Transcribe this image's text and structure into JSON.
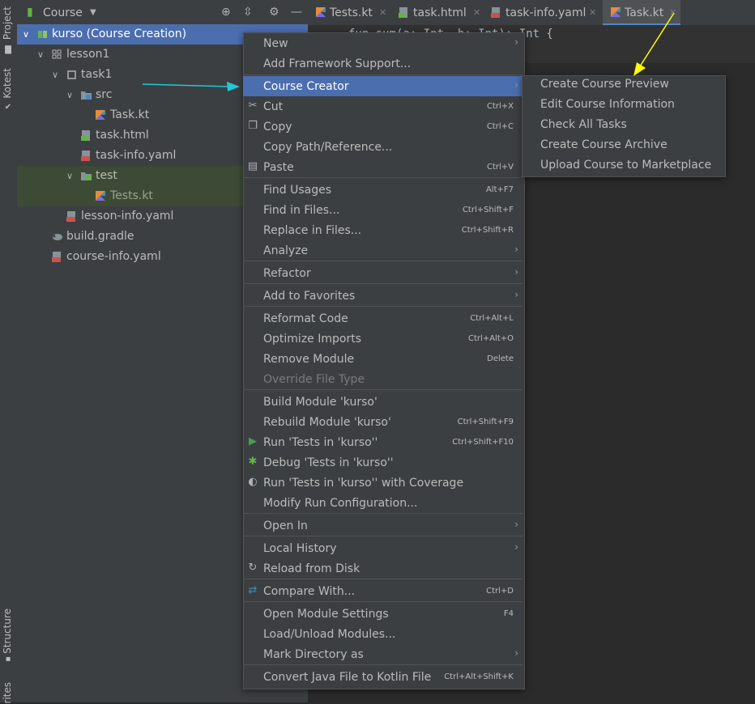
{
  "toolstrip": {
    "project": "Project",
    "kotest": "Kotest",
    "structure": "Structure",
    "favorites": "rites"
  },
  "project_panel": {
    "title": "Course",
    "tree": [
      {
        "label": "kurso (Course Creation)"
      },
      {
        "label": "lesson1"
      },
      {
        "label": "task1"
      },
      {
        "label": "src"
      },
      {
        "label": "Task.kt"
      },
      {
        "label": "task.html"
      },
      {
        "label": "task-info.yaml"
      },
      {
        "label": "test"
      },
      {
        "label": "Tests.kt"
      },
      {
        "label": "lesson-info.yaml"
      },
      {
        "label": "build.gradle"
      },
      {
        "label": "course-info.yaml"
      }
    ]
  },
  "tabs": [
    {
      "label": "Tests.kt"
    },
    {
      "label": "task.html"
    },
    {
      "label": "task-info.yaml"
    },
    {
      "label": "Task.kt",
      "active": true
    }
  ],
  "editor": {
    "code_fragment": "fun sum(a: Int, b: Int): Int {"
  },
  "context_menu": {
    "items": [
      {
        "label": "New",
        "submenu": true
      },
      {
        "label": "Add Framework Support..."
      },
      {
        "label": "Course Creator",
        "submenu": true,
        "highlighted": true
      },
      {
        "label": "Cut",
        "shortcut": "Ctrl+X",
        "icon": "scissors-icon"
      },
      {
        "label": "Copy",
        "shortcut": "Ctrl+C",
        "icon": "copy-icon"
      },
      {
        "label": "Copy Path/Reference..."
      },
      {
        "label": "Paste",
        "shortcut": "Ctrl+V",
        "icon": "paste-icon"
      },
      {
        "label": "Find Usages",
        "shortcut": "Alt+F7"
      },
      {
        "label": "Find in Files...",
        "shortcut": "Ctrl+Shift+F"
      },
      {
        "label": "Replace in Files...",
        "shortcut": "Ctrl+Shift+R"
      },
      {
        "label": "Analyze",
        "submenu": true
      },
      {
        "label": "Refactor",
        "submenu": true
      },
      {
        "label": "Add to Favorites",
        "submenu": true
      },
      {
        "label": "Reformat Code",
        "shortcut": "Ctrl+Alt+L"
      },
      {
        "label": "Optimize Imports",
        "shortcut": "Ctrl+Alt+O"
      },
      {
        "label": "Remove Module",
        "shortcut": "Delete"
      },
      {
        "label": "Override File Type",
        "disabled": true
      },
      {
        "label": "Build Module 'kurso'"
      },
      {
        "label": "Rebuild Module 'kurso'",
        "shortcut": "Ctrl+Shift+F9"
      },
      {
        "label": "Run 'Tests in 'kurso''",
        "shortcut": "Ctrl+Shift+F10",
        "icon": "run-icon"
      },
      {
        "label": "Debug 'Tests in 'kurso''",
        "icon": "debug-icon"
      },
      {
        "label": "Run 'Tests in 'kurso'' with Coverage",
        "icon": "coverage-icon"
      },
      {
        "label": "Modify Run Configuration..."
      },
      {
        "label": "Open In",
        "submenu": true
      },
      {
        "label": "Local History",
        "submenu": true
      },
      {
        "label": "Reload from Disk",
        "icon": "reload-icon"
      },
      {
        "label": "Compare With...",
        "shortcut": "Ctrl+D",
        "icon": "compare-icon"
      },
      {
        "label": "Open Module Settings",
        "shortcut": "F4"
      },
      {
        "label": "Load/Unload Modules..."
      },
      {
        "label": "Mark Directory as",
        "submenu": true
      },
      {
        "label": "Convert Java File to Kotlin File",
        "shortcut": "Ctrl+Alt+Shift+K"
      }
    ]
  },
  "submenu": {
    "items": [
      {
        "label": "Create Course Preview"
      },
      {
        "label": "Edit Course Information"
      },
      {
        "label": "Check All Tasks"
      },
      {
        "label": "Create Course Archive"
      },
      {
        "label": "Upload Course to Marketplace"
      }
    ]
  },
  "colors": {
    "selection": "#4b6eaf",
    "test_folder_bg": "#3d4b36",
    "annotation_cyan": "#1fc8d8",
    "annotation_yellow": "#ffff00"
  }
}
